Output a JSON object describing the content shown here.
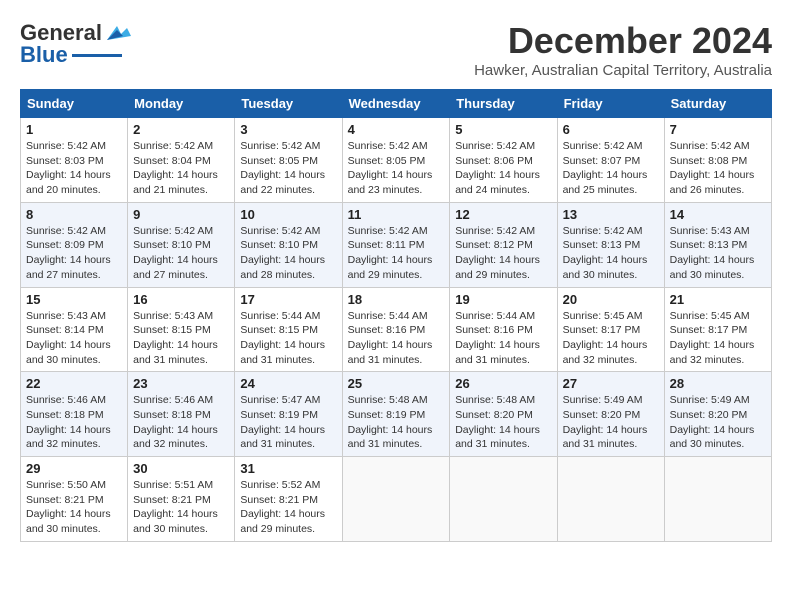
{
  "header": {
    "logo_general": "General",
    "logo_blue": "Blue",
    "month_title": "December 2024",
    "location": "Hawker, Australian Capital Territory, Australia"
  },
  "days_of_week": [
    "Sunday",
    "Monday",
    "Tuesday",
    "Wednesday",
    "Thursday",
    "Friday",
    "Saturday"
  ],
  "weeks": [
    [
      {
        "day": "1",
        "sunrise": "Sunrise: 5:42 AM",
        "sunset": "Sunset: 8:03 PM",
        "daylight": "Daylight: 14 hours and 20 minutes."
      },
      {
        "day": "2",
        "sunrise": "Sunrise: 5:42 AM",
        "sunset": "Sunset: 8:04 PM",
        "daylight": "Daylight: 14 hours and 21 minutes."
      },
      {
        "day": "3",
        "sunrise": "Sunrise: 5:42 AM",
        "sunset": "Sunset: 8:05 PM",
        "daylight": "Daylight: 14 hours and 22 minutes."
      },
      {
        "day": "4",
        "sunrise": "Sunrise: 5:42 AM",
        "sunset": "Sunset: 8:05 PM",
        "daylight": "Daylight: 14 hours and 23 minutes."
      },
      {
        "day": "5",
        "sunrise": "Sunrise: 5:42 AM",
        "sunset": "Sunset: 8:06 PM",
        "daylight": "Daylight: 14 hours and 24 minutes."
      },
      {
        "day": "6",
        "sunrise": "Sunrise: 5:42 AM",
        "sunset": "Sunset: 8:07 PM",
        "daylight": "Daylight: 14 hours and 25 minutes."
      },
      {
        "day": "7",
        "sunrise": "Sunrise: 5:42 AM",
        "sunset": "Sunset: 8:08 PM",
        "daylight": "Daylight: 14 hours and 26 minutes."
      }
    ],
    [
      {
        "day": "8",
        "sunrise": "Sunrise: 5:42 AM",
        "sunset": "Sunset: 8:09 PM",
        "daylight": "Daylight: 14 hours and 27 minutes."
      },
      {
        "day": "9",
        "sunrise": "Sunrise: 5:42 AM",
        "sunset": "Sunset: 8:10 PM",
        "daylight": "Daylight: 14 hours and 27 minutes."
      },
      {
        "day": "10",
        "sunrise": "Sunrise: 5:42 AM",
        "sunset": "Sunset: 8:10 PM",
        "daylight": "Daylight: 14 hours and 28 minutes."
      },
      {
        "day": "11",
        "sunrise": "Sunrise: 5:42 AM",
        "sunset": "Sunset: 8:11 PM",
        "daylight": "Daylight: 14 hours and 29 minutes."
      },
      {
        "day": "12",
        "sunrise": "Sunrise: 5:42 AM",
        "sunset": "Sunset: 8:12 PM",
        "daylight": "Daylight: 14 hours and 29 minutes."
      },
      {
        "day": "13",
        "sunrise": "Sunrise: 5:42 AM",
        "sunset": "Sunset: 8:13 PM",
        "daylight": "Daylight: 14 hours and 30 minutes."
      },
      {
        "day": "14",
        "sunrise": "Sunrise: 5:43 AM",
        "sunset": "Sunset: 8:13 PM",
        "daylight": "Daylight: 14 hours and 30 minutes."
      }
    ],
    [
      {
        "day": "15",
        "sunrise": "Sunrise: 5:43 AM",
        "sunset": "Sunset: 8:14 PM",
        "daylight": "Daylight: 14 hours and 30 minutes."
      },
      {
        "day": "16",
        "sunrise": "Sunrise: 5:43 AM",
        "sunset": "Sunset: 8:15 PM",
        "daylight": "Daylight: 14 hours and 31 minutes."
      },
      {
        "day": "17",
        "sunrise": "Sunrise: 5:44 AM",
        "sunset": "Sunset: 8:15 PM",
        "daylight": "Daylight: 14 hours and 31 minutes."
      },
      {
        "day": "18",
        "sunrise": "Sunrise: 5:44 AM",
        "sunset": "Sunset: 8:16 PM",
        "daylight": "Daylight: 14 hours and 31 minutes."
      },
      {
        "day": "19",
        "sunrise": "Sunrise: 5:44 AM",
        "sunset": "Sunset: 8:16 PM",
        "daylight": "Daylight: 14 hours and 31 minutes."
      },
      {
        "day": "20",
        "sunrise": "Sunrise: 5:45 AM",
        "sunset": "Sunset: 8:17 PM",
        "daylight": "Daylight: 14 hours and 32 minutes."
      },
      {
        "day": "21",
        "sunrise": "Sunrise: 5:45 AM",
        "sunset": "Sunset: 8:17 PM",
        "daylight": "Daylight: 14 hours and 32 minutes."
      }
    ],
    [
      {
        "day": "22",
        "sunrise": "Sunrise: 5:46 AM",
        "sunset": "Sunset: 8:18 PM",
        "daylight": "Daylight: 14 hours and 32 minutes."
      },
      {
        "day": "23",
        "sunrise": "Sunrise: 5:46 AM",
        "sunset": "Sunset: 8:18 PM",
        "daylight": "Daylight: 14 hours and 32 minutes."
      },
      {
        "day": "24",
        "sunrise": "Sunrise: 5:47 AM",
        "sunset": "Sunset: 8:19 PM",
        "daylight": "Daylight: 14 hours and 31 minutes."
      },
      {
        "day": "25",
        "sunrise": "Sunrise: 5:48 AM",
        "sunset": "Sunset: 8:19 PM",
        "daylight": "Daylight: 14 hours and 31 minutes."
      },
      {
        "day": "26",
        "sunrise": "Sunrise: 5:48 AM",
        "sunset": "Sunset: 8:20 PM",
        "daylight": "Daylight: 14 hours and 31 minutes."
      },
      {
        "day": "27",
        "sunrise": "Sunrise: 5:49 AM",
        "sunset": "Sunset: 8:20 PM",
        "daylight": "Daylight: 14 hours and 31 minutes."
      },
      {
        "day": "28",
        "sunrise": "Sunrise: 5:49 AM",
        "sunset": "Sunset: 8:20 PM",
        "daylight": "Daylight: 14 hours and 30 minutes."
      }
    ],
    [
      {
        "day": "29",
        "sunrise": "Sunrise: 5:50 AM",
        "sunset": "Sunset: 8:21 PM",
        "daylight": "Daylight: 14 hours and 30 minutes."
      },
      {
        "day": "30",
        "sunrise": "Sunrise: 5:51 AM",
        "sunset": "Sunset: 8:21 PM",
        "daylight": "Daylight: 14 hours and 30 minutes."
      },
      {
        "day": "31",
        "sunrise": "Sunrise: 5:52 AM",
        "sunset": "Sunset: 8:21 PM",
        "daylight": "Daylight: 14 hours and 29 minutes."
      },
      null,
      null,
      null,
      null
    ]
  ]
}
